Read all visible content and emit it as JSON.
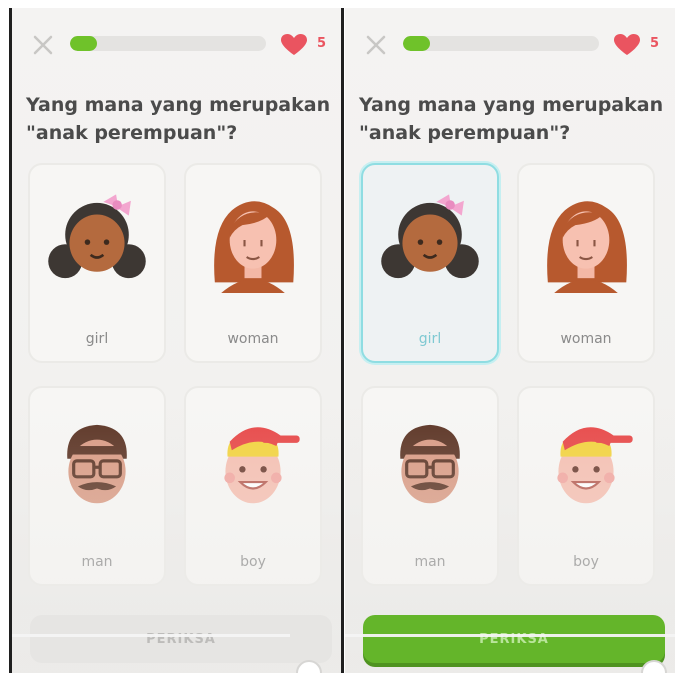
{
  "question": "Yang mana yang merupakan \"anak perempuan\"?",
  "lives": "5",
  "progress_fraction": 0.14,
  "check_label": "PERIKSA",
  "options": [
    "girl",
    "woman",
    "man",
    "boy"
  ],
  "colors": {
    "green": "#6fc22a",
    "heart": "#ea5460",
    "selected_border": "#8fdde2",
    "text": "#4b4b4b"
  },
  "icons": [
    "close-icon",
    "heart-icon",
    "girl-avatar-icon",
    "woman-avatar-icon",
    "man-avatar-icon",
    "boy-avatar-icon"
  ]
}
